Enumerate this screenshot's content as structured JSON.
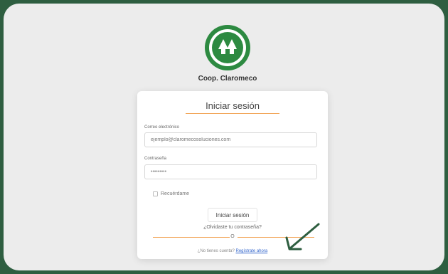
{
  "brand": {
    "name": "Coop. Claromeco",
    "logo": "double-tree-logo",
    "color": "#2d8a41"
  },
  "card": {
    "title": "Iniciar sesión",
    "email": {
      "label": "Correo electrónico",
      "placeholder": "ejemplo@claromecosoluciones.com"
    },
    "password": {
      "label": "Contraseña",
      "value": "•••••••••"
    },
    "remember_label": "Recuérdame",
    "login_button": "Iniciar sesión",
    "forgot_link": "¿Olvidaste tu contraseña?",
    "separator_text": "O",
    "register_prompt": "¿No tienes cuenta?",
    "register_link": "Regístrate ahora"
  },
  "annotation": {
    "arrow": "arrow-pointing-to-register-link",
    "color": "#2e5e40"
  },
  "colors": {
    "accent_line": "#f2a65a",
    "background": "#ececec",
    "frame": "#2e5e40"
  }
}
